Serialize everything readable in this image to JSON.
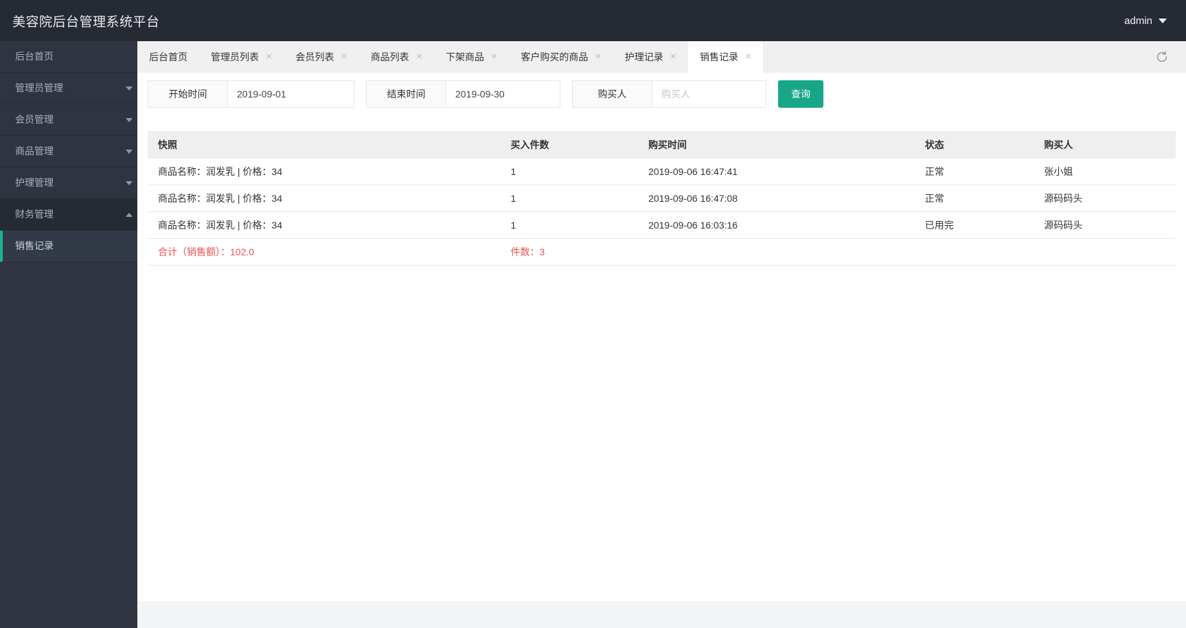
{
  "header": {
    "title": "美容院后台管理系统平台",
    "user": "admin"
  },
  "sidebar": {
    "items": [
      {
        "label": "后台首页",
        "chevron": "none",
        "state": "normal"
      },
      {
        "label": "管理员管理",
        "chevron": "down",
        "state": "normal"
      },
      {
        "label": "会员管理",
        "chevron": "down",
        "state": "normal"
      },
      {
        "label": "商品管理",
        "chevron": "down",
        "state": "normal"
      },
      {
        "label": "护理管理",
        "chevron": "down",
        "state": "normal"
      },
      {
        "label": "财务管理",
        "chevron": "up",
        "state": "expanded"
      },
      {
        "label": "销售记录",
        "chevron": "none",
        "state": "active"
      }
    ]
  },
  "tabbar": {
    "tabs": [
      {
        "label": "后台首页",
        "closable": false,
        "active": false
      },
      {
        "label": "管理员列表",
        "closable": true,
        "active": false
      },
      {
        "label": "会员列表",
        "closable": true,
        "active": false
      },
      {
        "label": "商品列表",
        "closable": true,
        "active": false
      },
      {
        "label": "下架商品",
        "closable": true,
        "active": false
      },
      {
        "label": "客户购买的商品",
        "closable": true,
        "active": false
      },
      {
        "label": "护理记录",
        "closable": true,
        "active": false
      },
      {
        "label": "销售记录",
        "closable": true,
        "active": true
      }
    ],
    "close_glyph": "×",
    "refresh_icon": "refresh-icon"
  },
  "filter": {
    "start_label": "开始时间",
    "start_value": "2019-09-01",
    "end_label": "结束时间",
    "end_value": "2019-09-30",
    "buyer_label": "购买人",
    "buyer_placeholder": "购买人",
    "buyer_value": "",
    "search_button": "查询"
  },
  "table": {
    "columns": [
      "快照",
      "买入件数",
      "购买时间",
      "状态",
      "购买人"
    ],
    "rows": [
      [
        "商品名称：润发乳 | 价格：34",
        "1",
        "2019-09-06 16:47:41",
        "正常",
        "张小姐"
      ],
      [
        "商品名称：润发乳 | 价格：34",
        "1",
        "2019-09-06 16:47:08",
        "正常",
        "源码码头"
      ],
      [
        "商品名称：润发乳 | 价格：34",
        "1",
        "2019-09-06 16:03:16",
        "已用完",
        "源码码头"
      ]
    ],
    "summary": {
      "total_label": "合计（销售额）：102.0",
      "count_label": "件数：3"
    }
  },
  "colors": {
    "accent": "#18a689",
    "active_border": "#1ab394",
    "danger": "#ed5050",
    "header_bg": "#262a33",
    "sidebar_bg": "#2f3440",
    "tabbar_bg": "#f0f0f0",
    "table_header_bg": "#efefef"
  }
}
